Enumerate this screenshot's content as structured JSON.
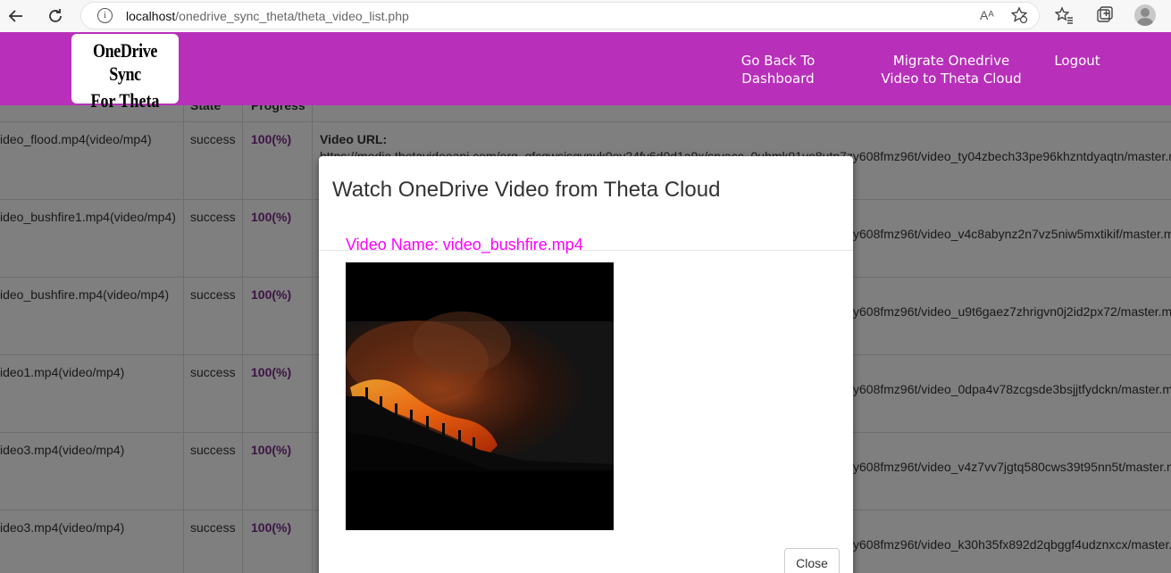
{
  "browser": {
    "url_host": "localhost",
    "url_path": "/onedrive_sync_theta/theta_video_list.php",
    "read_aloud": "Aᴬ"
  },
  "header": {
    "logo_line1": "OneDrive Sync",
    "logo_line2": "For Theta",
    "nav": [
      {
        "label": "Go Back To Dashboard"
      },
      {
        "label": "Migrate Onedrive Video to Theta Cloud"
      },
      {
        "label": "Logout"
      }
    ],
    "color": "#b82fba"
  },
  "table": {
    "columns": [
      "State",
      "Progress"
    ],
    "url_label": "Video URL:",
    "first_url": "https://media.thetavideoapi.com/org_gfcqwsisqvnyk0ey24fy6d0d1a9x/srvacc_0uhmk91vo8utn7zy608fmz96t/video_ty04zbech33pe96khzntdyaqtn/master.m",
    "rows": [
      {
        "name": "ideo_flood.mp4(video/mp4)",
        "state": "success",
        "progress": "100(%)",
        "url_tail": "y608fmz96t/video_ty04zbech33pe96khzntdyaqtn/master.r"
      },
      {
        "name": "ideo_bushfire1.mp4(video/mp4)",
        "state": "success",
        "progress": "100(%)",
        "url_tail": "y608fmz96t/video_v4c8abynz2n7vz5niw5mxtikif/master.m"
      },
      {
        "name": "ideo_bushfire.mp4(video/mp4)",
        "state": "success",
        "progress": "100(%)",
        "url_tail": "y608fmz96t/video_u9t6gaez7zhrigvn0j2id2px72/master.m"
      },
      {
        "name": "ideo1.mp4(video/mp4)",
        "state": "success",
        "progress": "100(%)",
        "url_tail": "y608fmz96t/video_0dpa4v78zcgsde3bsjjtfydckn/master.m"
      },
      {
        "name": "ideo3.mp4(video/mp4)",
        "state": "success",
        "progress": "100(%)",
        "url_tail": "y608fmz96t/video_v4z7vv7jgtq580cws39t95nn5t/master.m"
      },
      {
        "name": "ideo3.mp4(video/mp4)",
        "state": "success",
        "progress": "100(%)",
        "url_tail": "y608fmz96t/video_k30h35fx892d2qbggf4udznxcx/master."
      }
    ]
  },
  "modal": {
    "title": "Watch OneDrive Video from Theta Cloud",
    "video_name": "Video Name: video_bushfire.mp4",
    "close_label": "Close"
  }
}
